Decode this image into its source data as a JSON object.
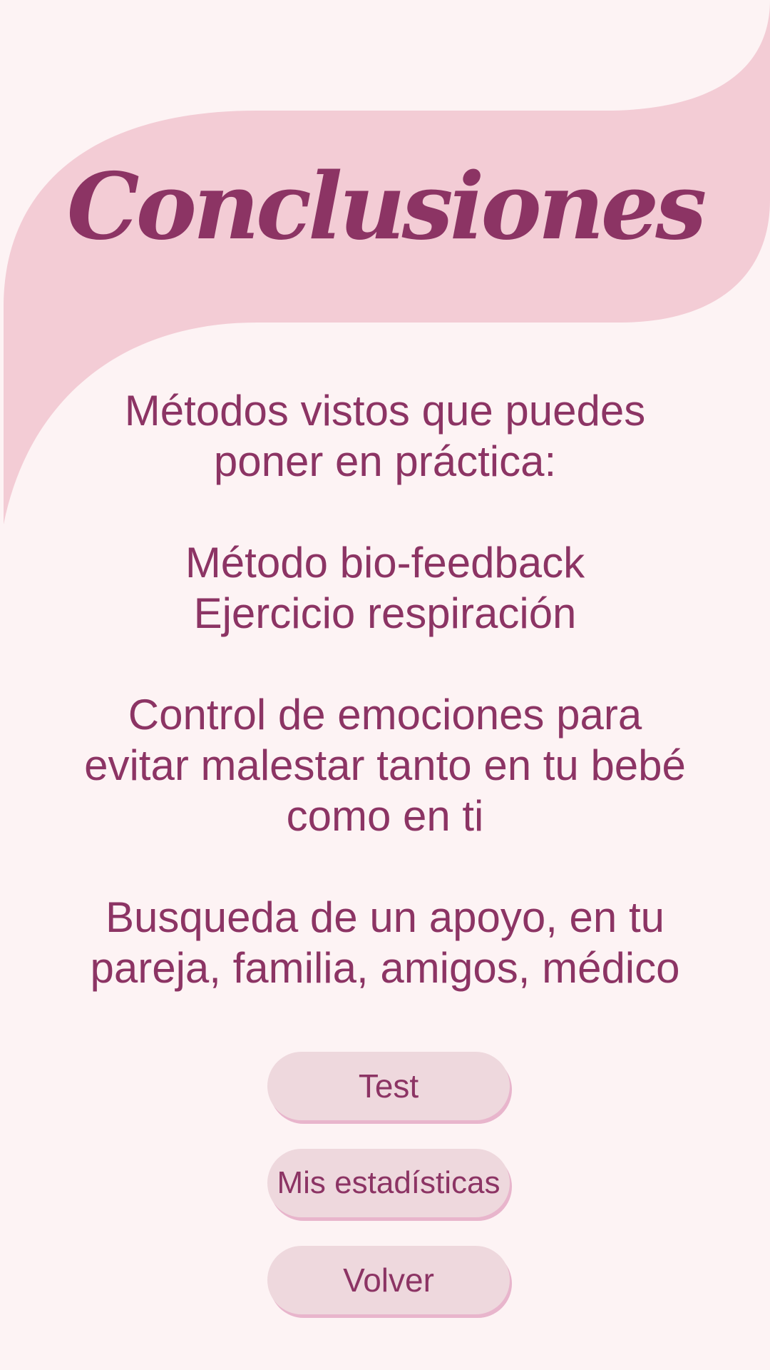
{
  "colors": {
    "background": "#fdf3f4",
    "banner": "#f3ccd5",
    "accent_text": "#8c3464",
    "button_bg": "#eed8dd",
    "button_shadow": "#e8b5cc"
  },
  "header": {
    "title": "Conclusiones"
  },
  "content": {
    "intro": [
      "Métodos vistos que puedes",
      "poner en práctica:"
    ],
    "methods": [
      "Método bio-feedback",
      "Ejercicio respiración"
    ],
    "emotions": [
      "Control de emociones para",
      "evitar malestar tanto en tu bebé",
      "como en ti"
    ],
    "support": [
      "Busqueda de un apoyo, en tu",
      "pareja, familia, amigos, médico"
    ]
  },
  "buttons": {
    "test_label": "Test",
    "stats_label": "Mis estadísticas",
    "back_label": "Volver"
  }
}
